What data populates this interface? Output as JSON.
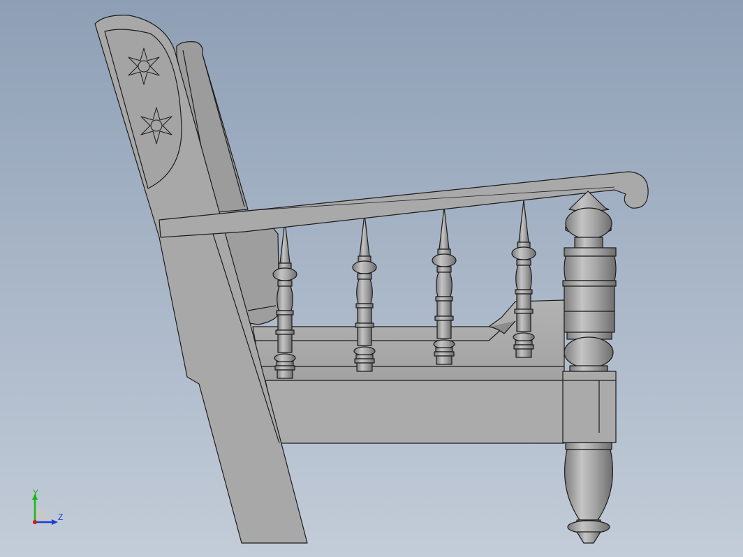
{
  "view": {
    "background_top": "#8e9fb5",
    "background_bottom": "#c3ccd8",
    "model_fill": "#a9a9a9",
    "model_shade": "#8f8f8f",
    "edge_color": "#1c1c1c"
  },
  "model": {
    "name": "chair-side-view",
    "carving_icon": "six-point-star-flower"
  },
  "triad": {
    "y_label": "Y",
    "z_label": "Z",
    "y_color": "#18b818",
    "z_color": "#1a3fd0",
    "x_color": "#d01818"
  }
}
